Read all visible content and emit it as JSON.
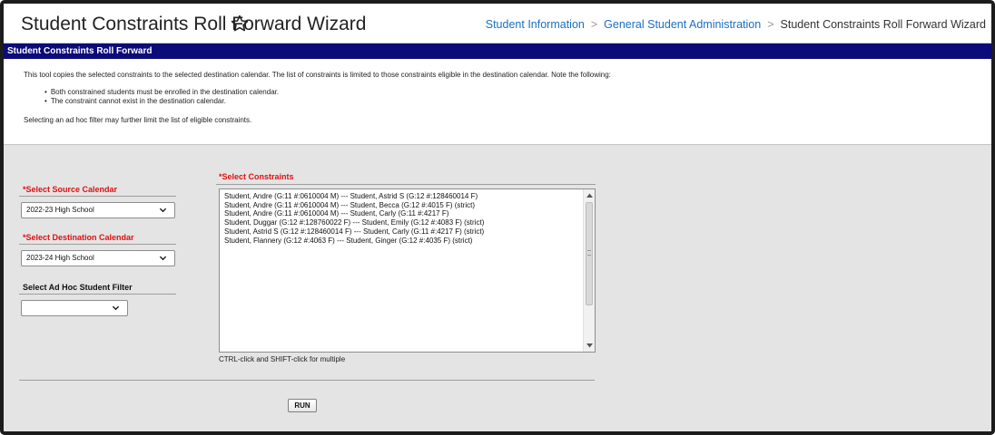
{
  "header": {
    "title": "Student Constraints Roll Forward Wizard",
    "breadcrumb": [
      {
        "label": "Student Information",
        "link": true
      },
      {
        "label": "General Student Administration",
        "link": true
      },
      {
        "label": "Student Constraints Roll Forward Wizard",
        "link": false
      }
    ],
    "separator": ">",
    "star_icon": "star-outline-icon"
  },
  "section_title": "Student Constraints Roll Forward",
  "description": {
    "intro": "This tool copies the selected constraints to the selected destination calendar. The list of constraints is limited to those constraints eligible in the destination calendar. Note the following:",
    "bullets": [
      "Both constrained students must be enrolled in the destination calendar.",
      "The constraint cannot exist in the destination calendar."
    ],
    "note": "Selecting an ad hoc filter may further limit the list of eligible constraints."
  },
  "form": {
    "source_calendar": {
      "label": "*Select Source Calendar",
      "value": "2022-23 High School"
    },
    "destination_calendar": {
      "label": "*Select Destination Calendar",
      "value": "2023-24 High School"
    },
    "ad_hoc_filter": {
      "label": "Select Ad Hoc Student Filter",
      "value": ""
    },
    "constraints": {
      "label": "*Select Constraints",
      "items": [
        "Student, Andre (G:11 #:0610004 M) --- Student, Astrid S (G:12 #:128460014 F)",
        "Student, Andre (G:11 #:0610004 M) --- Student, Becca (G:12 #:4015 F) (strict)",
        "Student, Andre (G:11 #:0610004 M) --- Student, Carly (G:11 #:4217 F)",
        "Student, Duggar (G:12 #:128760022 F) --- Student, Emily (G:12 #:4083 F) (strict)",
        "Student, Astrid S (G:12 #:128460014 F) --- Student, Carly (G:11 #:4217 F) (strict)",
        "Student, Flannery (G:12 #:4063 F) --- Student, Ginger (G:12 #:4035 F) (strict)"
      ],
      "hint": "CTRL-click and SHIFT-click for multiple"
    },
    "run_label": "RUN"
  },
  "colors": {
    "section_bar": "#0b0b7a",
    "required_label": "#e01010",
    "link": "#1a6fc4",
    "panel": "#e4e4e4"
  }
}
